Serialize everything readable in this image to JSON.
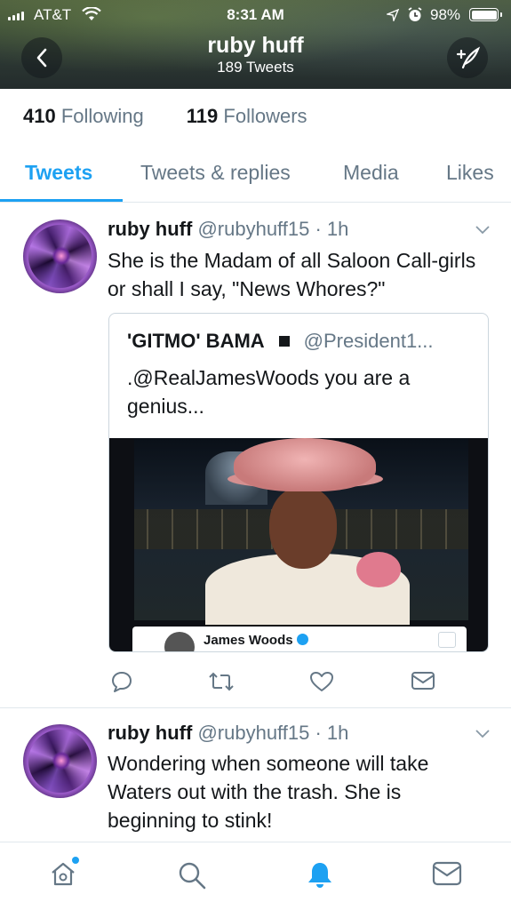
{
  "status_bar": {
    "carrier": "AT&T",
    "time": "8:31 AM",
    "battery_percent": "98%"
  },
  "header": {
    "title": "ruby huff",
    "subtitle": "189 Tweets"
  },
  "profile": {
    "following_count": "410",
    "following_label": "Following",
    "followers_count": "119",
    "followers_label": "Followers"
  },
  "tabs": [
    {
      "label": "Tweets",
      "active": true
    },
    {
      "label": "Tweets & replies",
      "active": false
    },
    {
      "label": "Media",
      "active": false
    },
    {
      "label": "Likes",
      "active": false
    }
  ],
  "tweets": [
    {
      "name": "ruby huff",
      "meta": "@rubyhuff15 · 1h",
      "text": "She is the Madam of all Saloon Call-girls or shall I say, \"News Whores?\"",
      "quote": {
        "name": "'GITMO' BAMA",
        "handle": "@President1...",
        "text": ".@RealJamesWoods you are a genius...",
        "embedded_card_name": "James Woods"
      }
    },
    {
      "name": "ruby huff",
      "meta": "@rubyhuff15 · 1h",
      "text": "Wondering when someone will take Waters out with the trash. She is beginning to stink!"
    }
  ],
  "icons": {
    "accent": "#1da1f2",
    "muted": "#657786"
  }
}
